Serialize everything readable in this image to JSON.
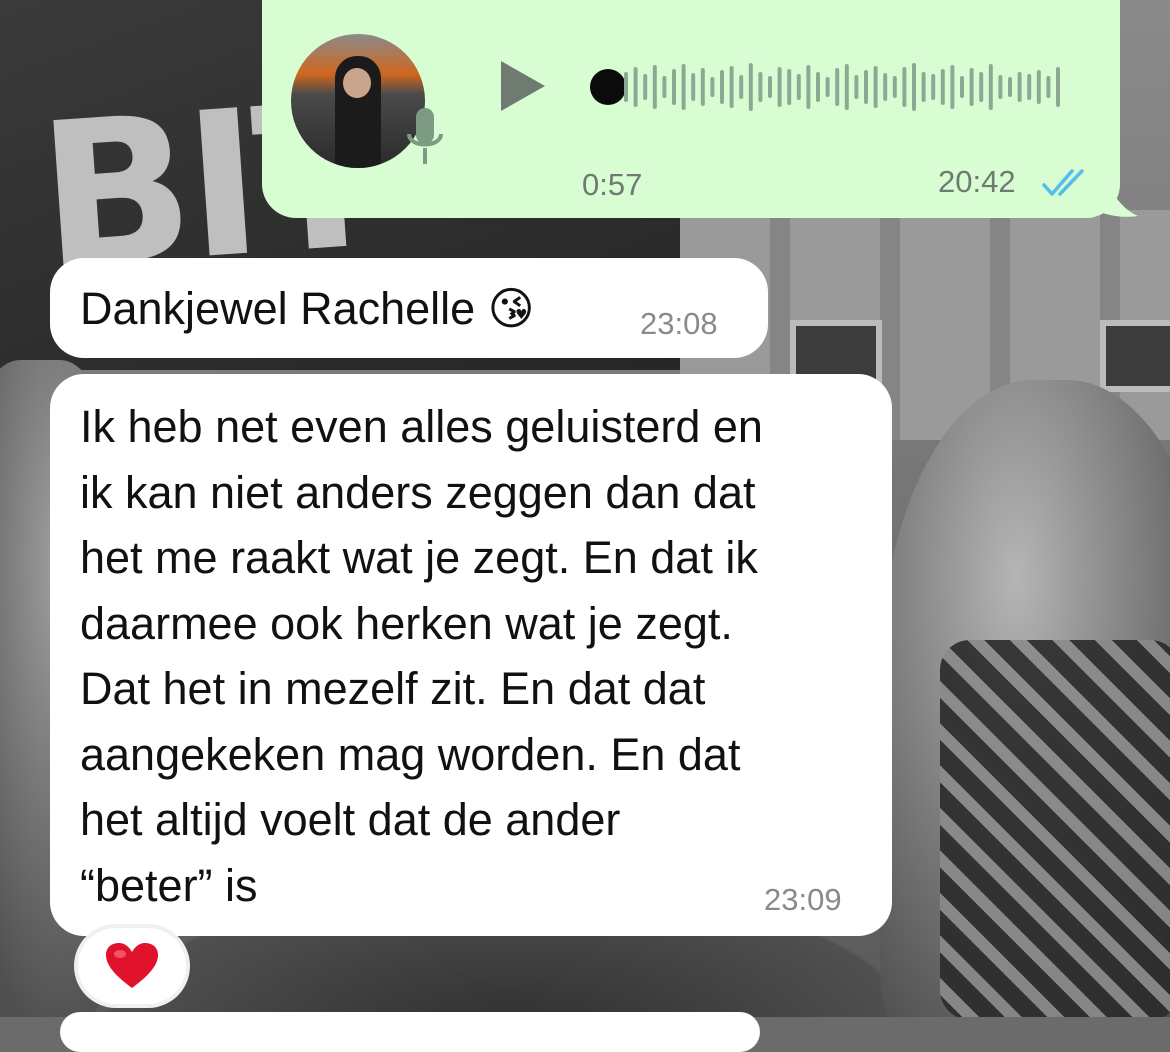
{
  "voice_message": {
    "duration": "0:57",
    "time": "20:42",
    "status": "read",
    "status_color": "#53bdeb",
    "bubble_color": "#d9fdd3",
    "icons": [
      "avatar",
      "mic-icon",
      "play-icon",
      "double-check-icon"
    ]
  },
  "messages": [
    {
      "text": "Dankjewel Rachelle",
      "emoji": "😘",
      "time": "23:08"
    },
    {
      "lines": [
        "Ik heb net even alles geluisterd en",
        "ik kan niet anders zeggen dan dat",
        "het me raakt wat je zegt. En dat ik",
        "daarmee ook herken wat je zegt.",
        "Dat het in mezelf zit. En dat dat",
        "aangekeken mag worden. En dat",
        "het altijd voelt dat de ander",
        "“beter” is"
      ],
      "time": "23:09",
      "reaction": "heart"
    }
  ],
  "colors": {
    "incoming_bubble": "#ffffff",
    "timestamp": "#8a8a8a",
    "reaction_heart": "#e0122c"
  }
}
